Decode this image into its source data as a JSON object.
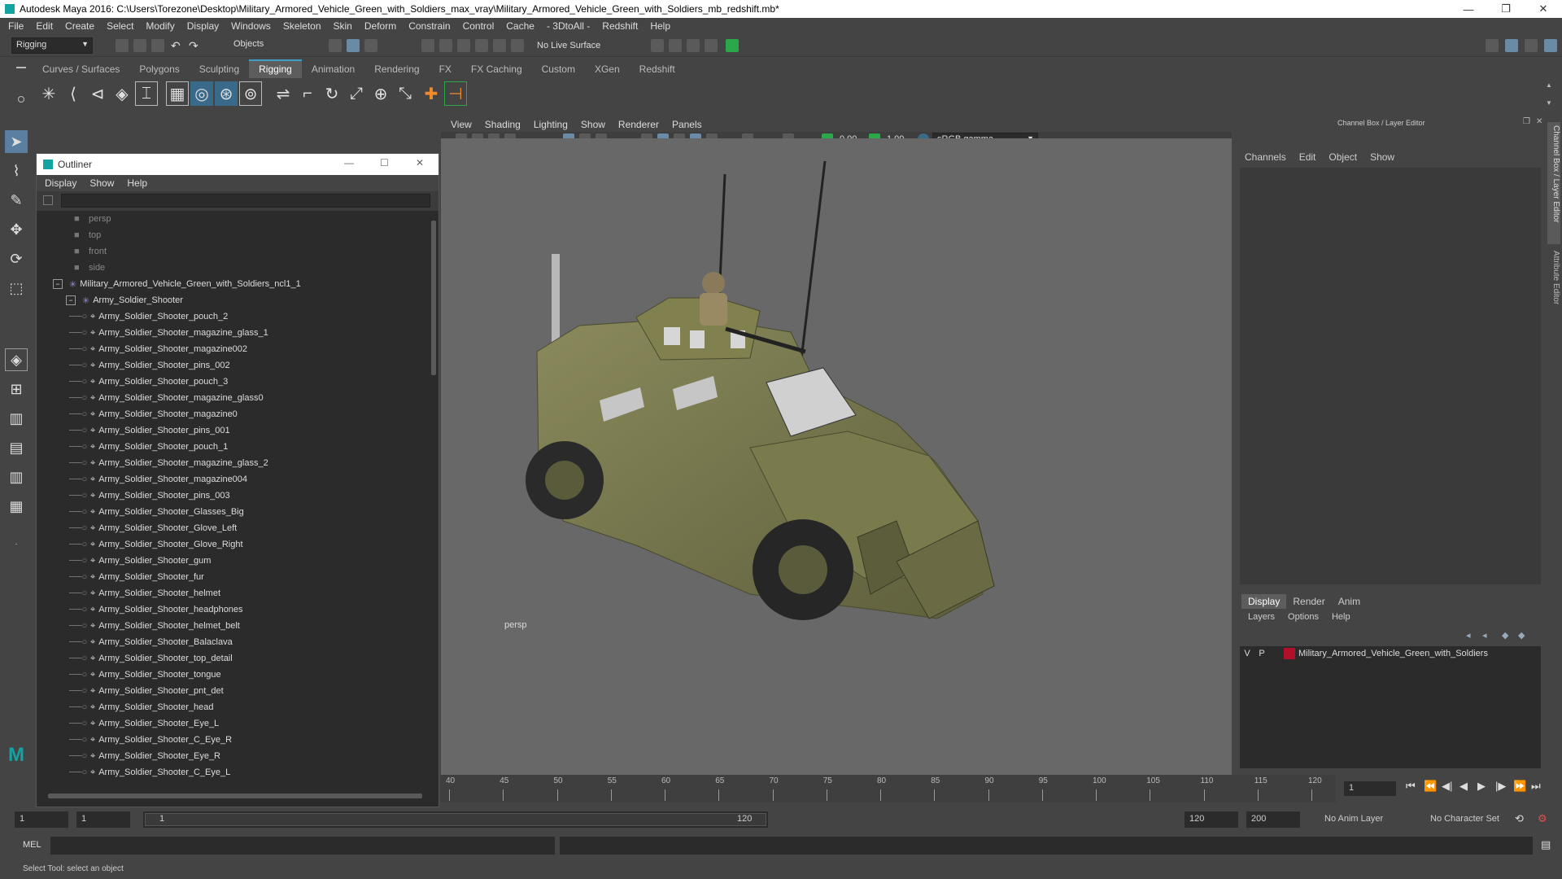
{
  "window": {
    "title": "Autodesk Maya 2016: C:\\Users\\Torezone\\Desktop\\Military_Armored_Vehicle_Green_with_Soldiers_max_vray\\Military_Armored_Vehicle_Green_with_Soldiers_mb_redshift.mb*"
  },
  "menubar": [
    "File",
    "Edit",
    "Create",
    "Select",
    "Modify",
    "Display",
    "Windows",
    "Skeleton",
    "Skin",
    "Deform",
    "Constrain",
    "Control",
    "Cache",
    "- 3DtoAll -",
    "Redshift",
    "Help"
  ],
  "statusline": {
    "mode": "Rigging",
    "objects_label": "Objects",
    "live_surface": "No Live Surface"
  },
  "shelf_tabs": [
    "Curves / Surfaces",
    "Polygons",
    "Sculpting",
    "Rigging",
    "Animation",
    "Rendering",
    "FX",
    "FX Caching",
    "Custom",
    "XGen",
    "Redshift"
  ],
  "shelf_active": "Rigging",
  "viewport": {
    "menu": [
      "View",
      "Shading",
      "Lighting",
      "Show",
      "Renderer",
      "Panels"
    ],
    "exposure": "0.00",
    "gamma": "1.00",
    "color_space": "sRGB gamma",
    "camera_label": "persp"
  },
  "outliner": {
    "title": "Outliner",
    "menu": [
      "Display",
      "Show",
      "Help"
    ],
    "cameras": [
      "persp",
      "top",
      "front",
      "side"
    ],
    "root": "Military_Armored_Vehicle_Green_with_Soldiers_ncl1_1",
    "group": "Army_Soldier_Shooter",
    "items": [
      "Army_Soldier_Shooter_pouch_2",
      "Army_Soldier_Shooter_magazine_glass_1",
      "Army_Soldier_Shooter_magazine002",
      "Army_Soldier_Shooter_pins_002",
      "Army_Soldier_Shooter_pouch_3",
      "Army_Soldier_Shooter_magazine_glass0",
      "Army_Soldier_Shooter_magazine0",
      "Army_Soldier_Shooter_pins_001",
      "Army_Soldier_Shooter_pouch_1",
      "Army_Soldier_Shooter_magazine_glass_2",
      "Army_Soldier_Shooter_magazine004",
      "Army_Soldier_Shooter_pins_003",
      "Army_Soldier_Shooter_Glasses_Big",
      "Army_Soldier_Shooter_Glove_Left",
      "Army_Soldier_Shooter_Glove_Right",
      "Army_Soldier_Shooter_gum",
      "Army_Soldier_Shooter_fur",
      "Army_Soldier_Shooter_helmet",
      "Army_Soldier_Shooter_headphones",
      "Army_Soldier_Shooter_helmet_belt",
      "Army_Soldier_Shooter_Balaclava",
      "Army_Soldier_Shooter_top_detail",
      "Army_Soldier_Shooter_tongue",
      "Army_Soldier_Shooter_pnt_det",
      "Army_Soldier_Shooter_head",
      "Army_Soldier_Shooter_Eye_L",
      "Army_Soldier_Shooter_C_Eye_R",
      "Army_Soldier_Shooter_Eye_R",
      "Army_Soldier_Shooter_C_Eye_L"
    ]
  },
  "channel_box": {
    "title": "Channel Box / Layer Editor",
    "menu": [
      "Channels",
      "Edit",
      "Object",
      "Show"
    ],
    "side_tabs": [
      "Channel Box / Layer Editor",
      "Attribute Editor"
    ],
    "layer_tabs": [
      "Display",
      "Render",
      "Anim"
    ],
    "layer_menu": [
      "Layers",
      "Options",
      "Help"
    ],
    "layer": {
      "v": "V",
      "p": "P",
      "name": "Military_Armored_Vehicle_Green_with_Soldiers",
      "color": "#b0102a"
    }
  },
  "timeline": {
    "ticks": [
      "40",
      "45",
      "50",
      "55",
      "60",
      "65",
      "70",
      "75",
      "80",
      "85",
      "90",
      "95",
      "100",
      "105",
      "110",
      "115",
      "120"
    ],
    "current_frame": "1"
  },
  "range": {
    "start": "1",
    "playback_start": "1",
    "slider_start": "1",
    "slider_end": "120",
    "playback_end": "120",
    "end": "200",
    "anim_layer": "No Anim Layer",
    "char_set": "No Character Set"
  },
  "cmdline": {
    "label": "MEL"
  },
  "help": {
    "text": "Select Tool: select an object"
  },
  "colors": {
    "accent": "#3e9ec8",
    "maya_logo": "#14a3a3"
  }
}
